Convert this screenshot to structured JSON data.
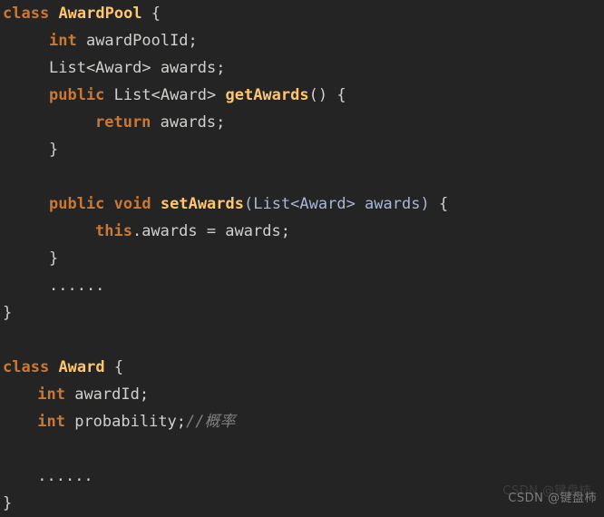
{
  "editor": {
    "background_color": "#242424",
    "font_size_px": 17,
    "line_height_px": 30,
    "language": "java",
    "colors": {
      "keyword": "#cc7832",
      "class_name": "#ffc66d",
      "method_name": "#ffc66d",
      "plain_text": "#d2d0cd",
      "parameter": "#a9b7d6",
      "comment": "#808080",
      "background": "#242424"
    },
    "lines": [
      {
        "n": 1,
        "indent": 0,
        "tokens": [
          {
            "t": "class",
            "c": "keyword"
          },
          {
            "t": " ",
            "c": "plain"
          },
          {
            "t": "AwardPool",
            "c": "classname"
          },
          {
            "t": " {",
            "c": "plain"
          }
        ]
      },
      {
        "n": 2,
        "indent": 4,
        "tokens": [
          {
            "t": "int",
            "c": "type"
          },
          {
            "t": " awardPoolId;",
            "c": "plain"
          }
        ]
      },
      {
        "n": 3,
        "indent": 4,
        "tokens": [
          {
            "t": "List<Award> awards;",
            "c": "plain"
          }
        ]
      },
      {
        "n": 4,
        "indent": 4,
        "tokens": [
          {
            "t": "public",
            "c": "keyword"
          },
          {
            "t": " List<Award> ",
            "c": "plain"
          },
          {
            "t": "getAwards",
            "c": "method"
          },
          {
            "t": "() {",
            "c": "plain"
          }
        ]
      },
      {
        "n": 5,
        "indent": 8,
        "tokens": [
          {
            "t": "return",
            "c": "keyword"
          },
          {
            "t": " awards;",
            "c": "plain"
          }
        ]
      },
      {
        "n": 6,
        "indent": 4,
        "tokens": [
          {
            "t": "}",
            "c": "plain"
          }
        ]
      },
      {
        "n": 7,
        "indent": 0,
        "tokens": []
      },
      {
        "n": 8,
        "indent": 4,
        "tokens": [
          {
            "t": "public",
            "c": "keyword"
          },
          {
            "t": " ",
            "c": "plain"
          },
          {
            "t": "void",
            "c": "keyword"
          },
          {
            "t": " ",
            "c": "plain"
          },
          {
            "t": "setAwards",
            "c": "method"
          },
          {
            "t": "(List<Award> awards)",
            "c": "param"
          },
          {
            "t": " {",
            "c": "plain"
          }
        ]
      },
      {
        "n": 9,
        "indent": 8,
        "tokens": [
          {
            "t": "this",
            "c": "keyword"
          },
          {
            "t": ".awards = awards;",
            "c": "plain"
          }
        ]
      },
      {
        "n": 10,
        "indent": 4,
        "tokens": [
          {
            "t": "}",
            "c": "plain"
          }
        ]
      },
      {
        "n": 11,
        "indent": 4,
        "tokens": [
          {
            "t": "......",
            "c": "dots"
          }
        ]
      },
      {
        "n": 12,
        "indent": 0,
        "tokens": [
          {
            "t": "}",
            "c": "plain"
          }
        ]
      },
      {
        "n": 13,
        "indent": 0,
        "tokens": []
      },
      {
        "n": 14,
        "indent": 0,
        "tokens": [
          {
            "t": "class",
            "c": "keyword"
          },
          {
            "t": " ",
            "c": "plain"
          },
          {
            "t": "Award",
            "c": "classname"
          },
          {
            "t": " {",
            "c": "plain"
          }
        ]
      },
      {
        "n": 15,
        "indent": 3,
        "tokens": [
          {
            "t": "int",
            "c": "type"
          },
          {
            "t": " awardId;",
            "c": "plain"
          }
        ]
      },
      {
        "n": 16,
        "indent": 3,
        "tokens": [
          {
            "t": "int",
            "c": "type"
          },
          {
            "t": " probability;",
            "c": "plain"
          },
          {
            "t": "//概率",
            "c": "comment"
          }
        ]
      },
      {
        "n": 17,
        "indent": 0,
        "tokens": []
      },
      {
        "n": 18,
        "indent": 3,
        "tokens": [
          {
            "t": "......",
            "c": "dots"
          }
        ]
      },
      {
        "n": 19,
        "indent": 0,
        "tokens": [
          {
            "t": "}",
            "c": "plain"
          }
        ]
      }
    ]
  },
  "watermark": {
    "text": "CSDN @键盘柿",
    "ghost_text": "CSDN @键盘柿"
  }
}
